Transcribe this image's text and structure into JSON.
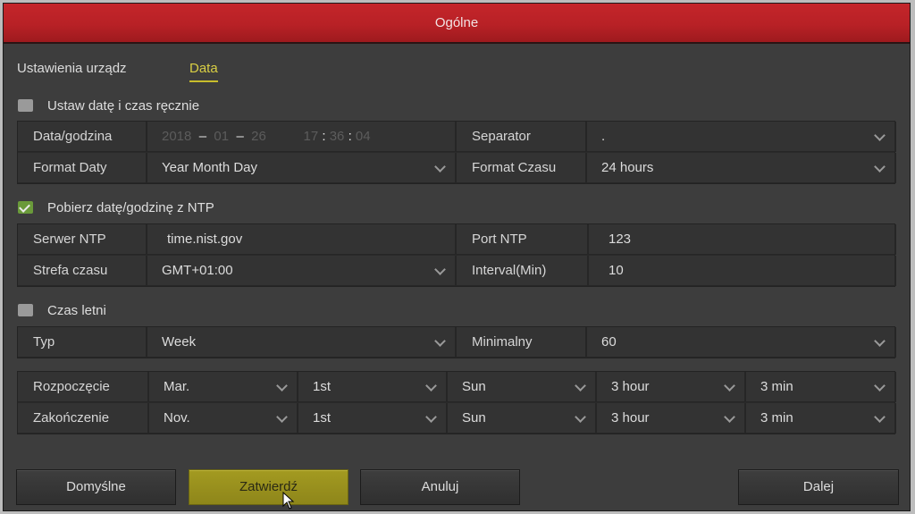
{
  "window": {
    "title": "Ogólne"
  },
  "tabs": [
    {
      "label": "Ustawienia urządz",
      "active": false
    },
    {
      "label": "Data",
      "active": true
    }
  ],
  "manual": {
    "checkbox_label": "Ustaw datę i czas ręcznie",
    "checked": false,
    "datetime_label": "Data/godzina",
    "date": {
      "year": "2018",
      "month": "01",
      "day": "26",
      "sep": "–"
    },
    "time": {
      "hour": "17",
      "minute": "36",
      "second": "04",
      "sep": ":"
    },
    "separator_label": "Separator",
    "separator_value": ".",
    "date_format_label": "Format Daty",
    "date_format_value": "Year Month Day",
    "time_format_label": "Format Czasu",
    "time_format_value": "24 hours"
  },
  "ntp": {
    "checkbox_label": "Pobierz datę/godzinę z NTP",
    "checked": true,
    "server_label": "Serwer NTP",
    "server_value": "time.nist.gov",
    "port_label": "Port NTP",
    "port_value": "123",
    "timezone_label": "Strefa czasu",
    "timezone_value": "GMT+01:00",
    "interval_label": "Interval(Min)",
    "interval_value": "10"
  },
  "dst": {
    "checkbox_label": "Czas letni",
    "checked": false,
    "type_label": "Typ",
    "type_value": "Week",
    "offset_label": "Minimalny",
    "offset_value": "60",
    "start": {
      "label": "Rozpoczęcie",
      "month": "Mar.",
      "week": "1st",
      "day": "Sun",
      "hour": "3 hour",
      "min": "3 min"
    },
    "end": {
      "label": "Zakończenie",
      "month": "Nov.",
      "week": "1st",
      "day": "Sun",
      "hour": "3 hour",
      "min": "3 min"
    }
  },
  "buttons": {
    "default": "Domyślne",
    "apply": "Zatwierdź",
    "cancel": "Anuluj",
    "next": "Dalej"
  },
  "colors": {
    "title_bar": "#b82126",
    "active_tab": "#d9cf44",
    "primary_button": "#9a921e",
    "background": "#3d3d3d"
  }
}
